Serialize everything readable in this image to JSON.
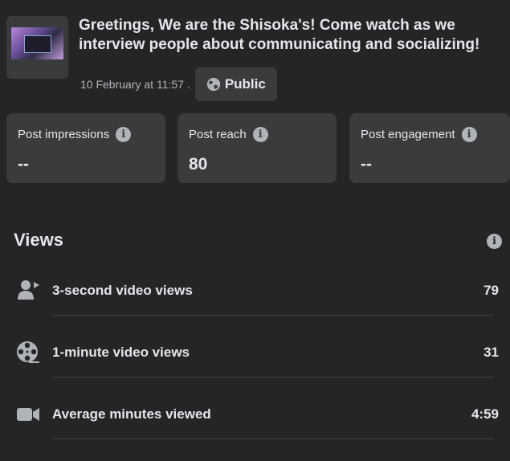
{
  "post": {
    "title": "Greetings, We are the Shisoka's! Come watch as we interview people about communicating and socializing!",
    "date": "10 February at 11:57",
    "separator": ".",
    "audience_label": "Public",
    "audience_icon": "globe-icon"
  },
  "stats": [
    {
      "label": "Post impressions",
      "value": "--"
    },
    {
      "label": "Post reach",
      "value": "80"
    },
    {
      "label": "Post engagement",
      "value": "--"
    }
  ],
  "views": {
    "title": "Views",
    "rows": [
      {
        "icon": "person-play-icon",
        "label": "3-second video views",
        "value": "79"
      },
      {
        "icon": "film-reel-icon",
        "label": "1-minute video views",
        "value": "31"
      },
      {
        "icon": "video-camera-icon",
        "label": "Average minutes viewed",
        "value": "4:59"
      }
    ]
  },
  "colors": {
    "background": "#242526",
    "card": "#3a3b3c",
    "text_primary": "#e4e6eb",
    "text_secondary": "#b0b3b8"
  }
}
